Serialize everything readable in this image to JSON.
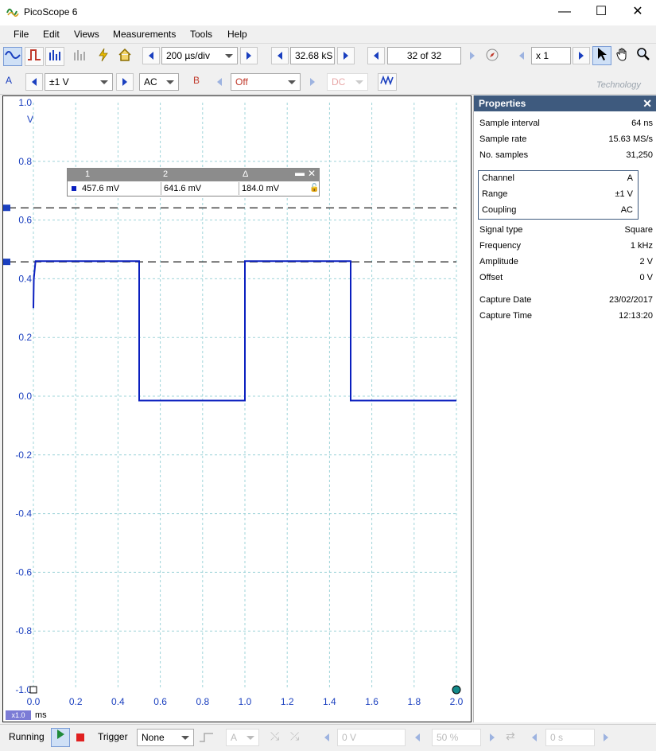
{
  "window": {
    "title": "PicoScope 6",
    "minimize": "—",
    "maximize": "☐",
    "close": "✕"
  },
  "menu": [
    {
      "label": "File"
    },
    {
      "label": "Edit"
    },
    {
      "label": "Views"
    },
    {
      "label": "Measurements"
    },
    {
      "label": "Tools"
    },
    {
      "label": "Help"
    }
  ],
  "toolbar": {
    "timebase": "200 µs/div",
    "samples": "32.68 kS",
    "buffer": "32 of 32",
    "zoom": "x 1",
    "watermark": "Technology"
  },
  "channel_a": {
    "letter": "A",
    "range": "±1 V",
    "coupling": "AC"
  },
  "channel_b": {
    "letter": "B",
    "range": "Off",
    "coupling": "DC"
  },
  "measurement": {
    "col1": "1",
    "col2": "2",
    "col3": "Δ",
    "val1": "457.6 mV",
    "val2": "641.6 mV",
    "val3": "184.0 mV"
  },
  "scope": {
    "y_ticks": [
      "1.0",
      "0.8",
      "0.6",
      "0.4",
      "0.2",
      "0.0",
      "-0.2",
      "-0.4",
      "-0.6",
      "-0.8",
      "-1.0"
    ],
    "y_unit": "V",
    "x_ticks": [
      "0.0",
      "0.2",
      "0.4",
      "0.6",
      "0.8",
      "1.0",
      "1.2",
      "1.4",
      "1.6",
      "1.8",
      "2.0"
    ],
    "x_unit": "ms",
    "zoom_badge": "x1.0",
    "trace_color": "#0a1fbf",
    "ruler_values_v": [
      0.6416,
      0.4576
    ]
  },
  "chart_data": {
    "type": "line",
    "title": "",
    "xlabel": "ms",
    "ylabel": "V",
    "xlim": [
      0,
      2.0
    ],
    "ylim": [
      -1.0,
      1.0
    ],
    "series": [
      {
        "x": [
          0.0,
          0.002,
          0.01,
          0.5,
          0.5,
          0.5,
          1.0,
          1.0,
          1.5,
          1.5,
          2.0
        ],
        "y": [
          0.3,
          0.4,
          0.46,
          0.46,
          0.1,
          -0.015,
          -0.015,
          0.46,
          0.46,
          -0.015,
          -0.015
        ]
      }
    ]
  },
  "properties": {
    "title": "Properties",
    "rows1": [
      {
        "label": "Sample interval",
        "value": "64 ns"
      },
      {
        "label": "Sample rate",
        "value": "15.63 MS/s"
      },
      {
        "label": "No. samples",
        "value": "31,250"
      }
    ],
    "rows2": [
      {
        "label": "Channel",
        "value": "A"
      },
      {
        "label": "Range",
        "value": "±1 V"
      },
      {
        "label": "Coupling",
        "value": "AC"
      }
    ],
    "rows3": [
      {
        "label": "Signal type",
        "value": "Square"
      },
      {
        "label": "Frequency",
        "value": "1 kHz"
      },
      {
        "label": "Amplitude",
        "value": "2 V"
      },
      {
        "label": "Offset",
        "value": "0 V"
      }
    ],
    "rows4": [
      {
        "label": "Capture Date",
        "value": "23/02/2017"
      },
      {
        "label": "Capture Time",
        "value": "12:13:20"
      }
    ]
  },
  "status": {
    "running": "Running",
    "trigger_label": "Trigger",
    "trigger_mode": "None",
    "trigger_channel": "A",
    "threshold": "0 V",
    "pretrigger": "50 %",
    "delay": "0 s"
  },
  "colors": {
    "accent": "#1a3fbf",
    "header": "#3e5a7e",
    "trace": "#0a1fbf",
    "channel_b": "#c0392b"
  }
}
